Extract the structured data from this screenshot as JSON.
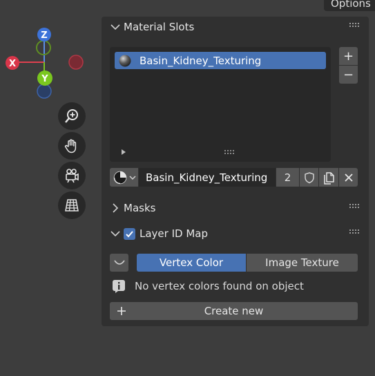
{
  "topbar": {
    "options_label": "Options"
  },
  "gizmo": {
    "x_label": "X",
    "y_label": "Y",
    "z_label": "Z"
  },
  "nav_icons": [
    "zoom-icon",
    "hand-pan-icon",
    "camera-icon",
    "grid-perspective-icon"
  ],
  "material_slots": {
    "title": "Material Slots",
    "items": [
      {
        "label": "Basin_Kidney_Texturing"
      }
    ],
    "material_name": "Basin_Kidney_Texturing",
    "user_count": "2",
    "add_symbol": "+",
    "remove_symbol": "−"
  },
  "masks": {
    "title": "Masks"
  },
  "layer_id_map": {
    "title": "Layer ID Map",
    "checked": true,
    "options": [
      "Vertex Color",
      "Image Texture"
    ],
    "selected": "Vertex Color",
    "info_text": "No vertex colors found on object",
    "create_label": "Create new"
  },
  "colors": {
    "accent": "#4772b3",
    "panel": "#303030",
    "background": "#3d3d3d",
    "button": "#545454"
  }
}
